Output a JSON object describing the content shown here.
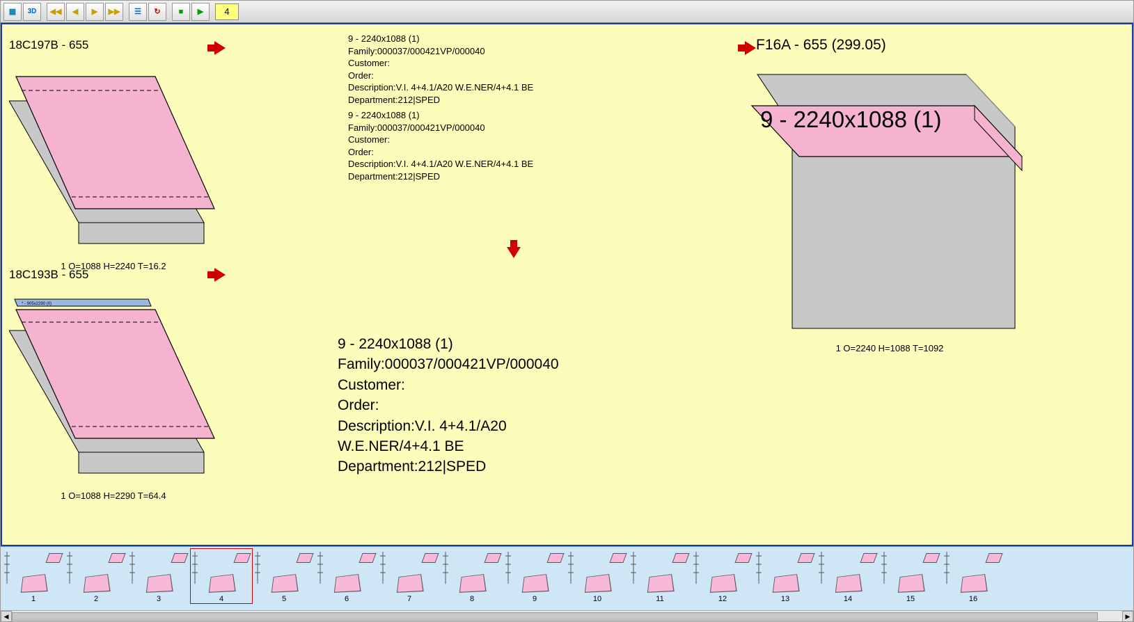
{
  "toolbar": {
    "btn_grid": "▦",
    "btn_3d": "3D",
    "btn_first": "◀◀",
    "btn_prev": "◀",
    "btn_next": "▶",
    "btn_last": "▶▶",
    "btn_list": "☰",
    "btn_loop": "↻",
    "btn_stop": "■",
    "btn_play": "▶",
    "step_value": "4"
  },
  "panel_tl": {
    "title": "18C197B - 655",
    "dims": "1 O=1088 H=2240 T=16.2"
  },
  "panel_bl": {
    "title": "18C193B - 655",
    "dims": "1 O=1088 H=2290 T=64.4"
  },
  "panel_right": {
    "title": "F16A - 655 (299.05)",
    "piece_label": "9 - 2240x1088  (1)",
    "dims": "1 O=2240 H=1088 T=1092"
  },
  "info_small_1": {
    "line1": "9 - 2240x1088 (1)",
    "line2": " Family:000037/000421VP/000040",
    "line3": " Customer:",
    "line4": " Order:",
    "line5": " Description:V.I. 4+4.1/A20 W.E.NER/4+4.1 BE",
    "line6": " Department:212|SPED"
  },
  "info_small_2": {
    "line1": "9 - 2240x1088 (1)",
    "line2": " Family:000037/000421VP/000040",
    "line3": " Customer:",
    "line4": " Order:",
    "line5": " Description:V.I. 4+4.1/A20 W.E.NER/4+4.1 BE",
    "line6": " Department:212|SPED"
  },
  "info_large": {
    "line1": "9 - 2240x1088 (1)",
    "line2": " Family:000037/000421VP/000040",
    "line3": " Customer:",
    "line4": " Order:",
    "line5": " Description:V.I. 4+4.1/A20",
    "line6": "W.E.NER/4+4.1 BE",
    "line7": " Department:212|SPED"
  },
  "thumbs": [
    {
      "n": "1"
    },
    {
      "n": "2"
    },
    {
      "n": "3"
    },
    {
      "n": "4"
    },
    {
      "n": "5"
    },
    {
      "n": "6"
    },
    {
      "n": "7"
    },
    {
      "n": "8"
    },
    {
      "n": "9"
    },
    {
      "n": "10"
    },
    {
      "n": "11"
    },
    {
      "n": "12"
    },
    {
      "n": "13"
    },
    {
      "n": "14"
    },
    {
      "n": "15"
    },
    {
      "n": "16"
    }
  ],
  "thumb_selected": 4
}
